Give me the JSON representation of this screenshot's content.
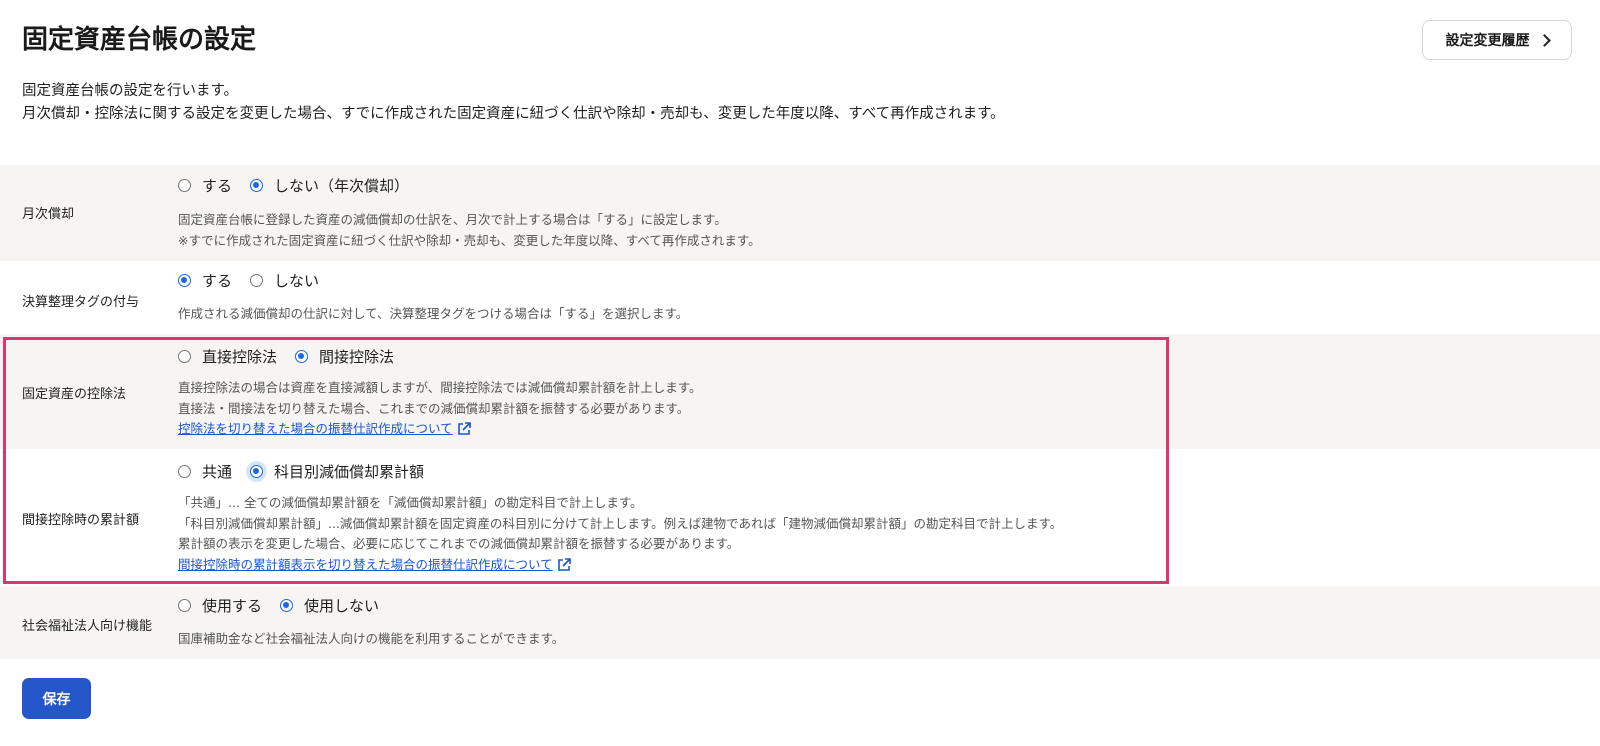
{
  "header": {
    "title": "固定資産台帳の設定",
    "history_button_label": "設定変更履歴"
  },
  "intro": {
    "line1": "固定資産台帳の設定を行います。",
    "line2": "月次償却・控除法に関する設定を変更した場合、すでに作成された固定資産に紐づく仕訳や除却・売却も、変更した年度以降、すべて再作成されます。"
  },
  "settings": [
    {
      "label": "月次償却",
      "options": [
        {
          "label": "する",
          "checked": false
        },
        {
          "label": "しない（年次償却）",
          "checked": true
        }
      ],
      "desc": [
        "固定資産台帳に登録した資産の減価償却の仕訳を、月次で計上する場合は「する」に設定します。",
        "※すでに作成された固定資産に紐づく仕訳や除却・売却も、変更した年度以降、すべて再作成されます。"
      ]
    },
    {
      "label": "決算整理タグの付与",
      "options": [
        {
          "label": "する",
          "checked": true
        },
        {
          "label": "しない",
          "checked": false
        }
      ],
      "desc": [
        "作成される減価償却の仕訳に対して、決算整理タグをつける場合は「する」を選択します。"
      ]
    },
    {
      "label": "固定資産の控除法",
      "options": [
        {
          "label": "直接控除法",
          "checked": false
        },
        {
          "label": "間接控除法",
          "checked": true
        }
      ],
      "desc": [
        "直接控除法の場合は資産を直接減額しますが、間接控除法では減価償却累計額を計上します。",
        "直接法・間接法を切り替えた場合、これまでの減価償却累計額を振替する必要があります。"
      ],
      "link": "控除法を切り替えた場合の振替仕訳作成について"
    },
    {
      "label": "間接控除時の累計額",
      "options": [
        {
          "label": "共通",
          "checked": false
        },
        {
          "label": "科目別減価償却累計額",
          "checked": true
        }
      ],
      "desc": [
        "「共通」... 全ての減価償却累計額を「減価償却累計額」の勘定科目で計上します。",
        "「科目別減価償却累計額」...減価償却累計額を固定資産の科目別に分けて計上します。例えば建物であれば「建物減価償却累計額」の勘定科目で計上します。",
        "累計額の表示を変更した場合、必要に応じてこれまでの減価償却累計額を振替する必要があります。"
      ],
      "link": "間接控除時の累計額表示を切り替えた場合の振替仕訳作成について"
    },
    {
      "label": "社会福祉法人向け機能",
      "options": [
        {
          "label": "使用する",
          "checked": false
        },
        {
          "label": "使用しない",
          "checked": true
        }
      ],
      "desc": [
        "国庫補助金など社会福祉法人向けの機能を利用することができます。"
      ]
    }
  ],
  "footer": {
    "save_label": "保存"
  },
  "colors": {
    "accent": "#1a66e6",
    "save_button": "#2455c9",
    "highlight": "#e0336f",
    "row_gray": "#f6f5f3",
    "link": "#1a55d6"
  }
}
